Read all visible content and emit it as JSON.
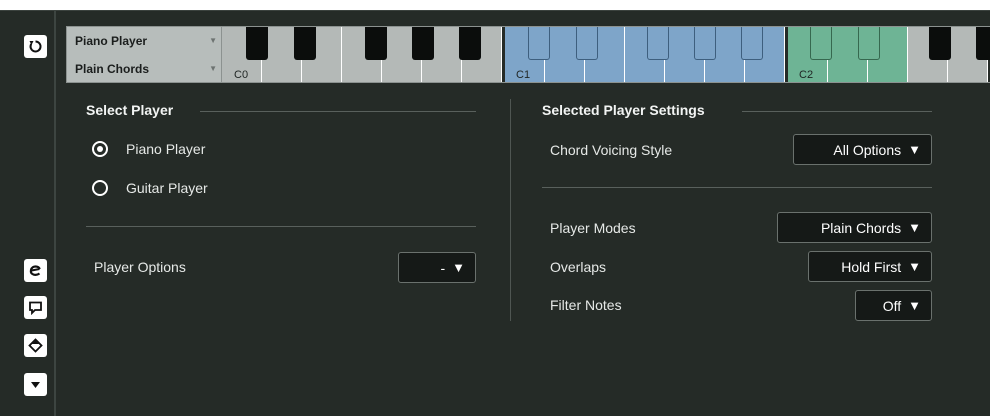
{
  "player_selector": {
    "player_value": "Piano Player",
    "style_value": "Plain Chords"
  },
  "keyboard": {
    "octave_labels": [
      "C0",
      "C1",
      "C2"
    ]
  },
  "select_player": {
    "title": "Select Player",
    "options": [
      "Piano Player",
      "Guitar Player"
    ],
    "selected": "Piano Player",
    "player_options_label": "Player Options",
    "player_options_value": "-"
  },
  "settings": {
    "title": "Selected Player Settings",
    "chord_voicing_style": {
      "label": "Chord Voicing Style",
      "value": "All Options"
    },
    "player_modes": {
      "label": "Player Modes",
      "value": "Plain Chords"
    },
    "overlaps": {
      "label": "Overlaps",
      "value": "Hold First"
    },
    "filter_notes": {
      "label": "Filter Notes",
      "value": "Off"
    }
  },
  "toolbar_icons": [
    "activate-icon",
    "editor-icon",
    "comment-icon",
    "tag-icon",
    "expand-icon"
  ],
  "colors": {
    "background": "#252b27",
    "key_grey": "#b4b9b7",
    "key_blue": "#7ea5c9",
    "key_green": "#6eb495"
  }
}
